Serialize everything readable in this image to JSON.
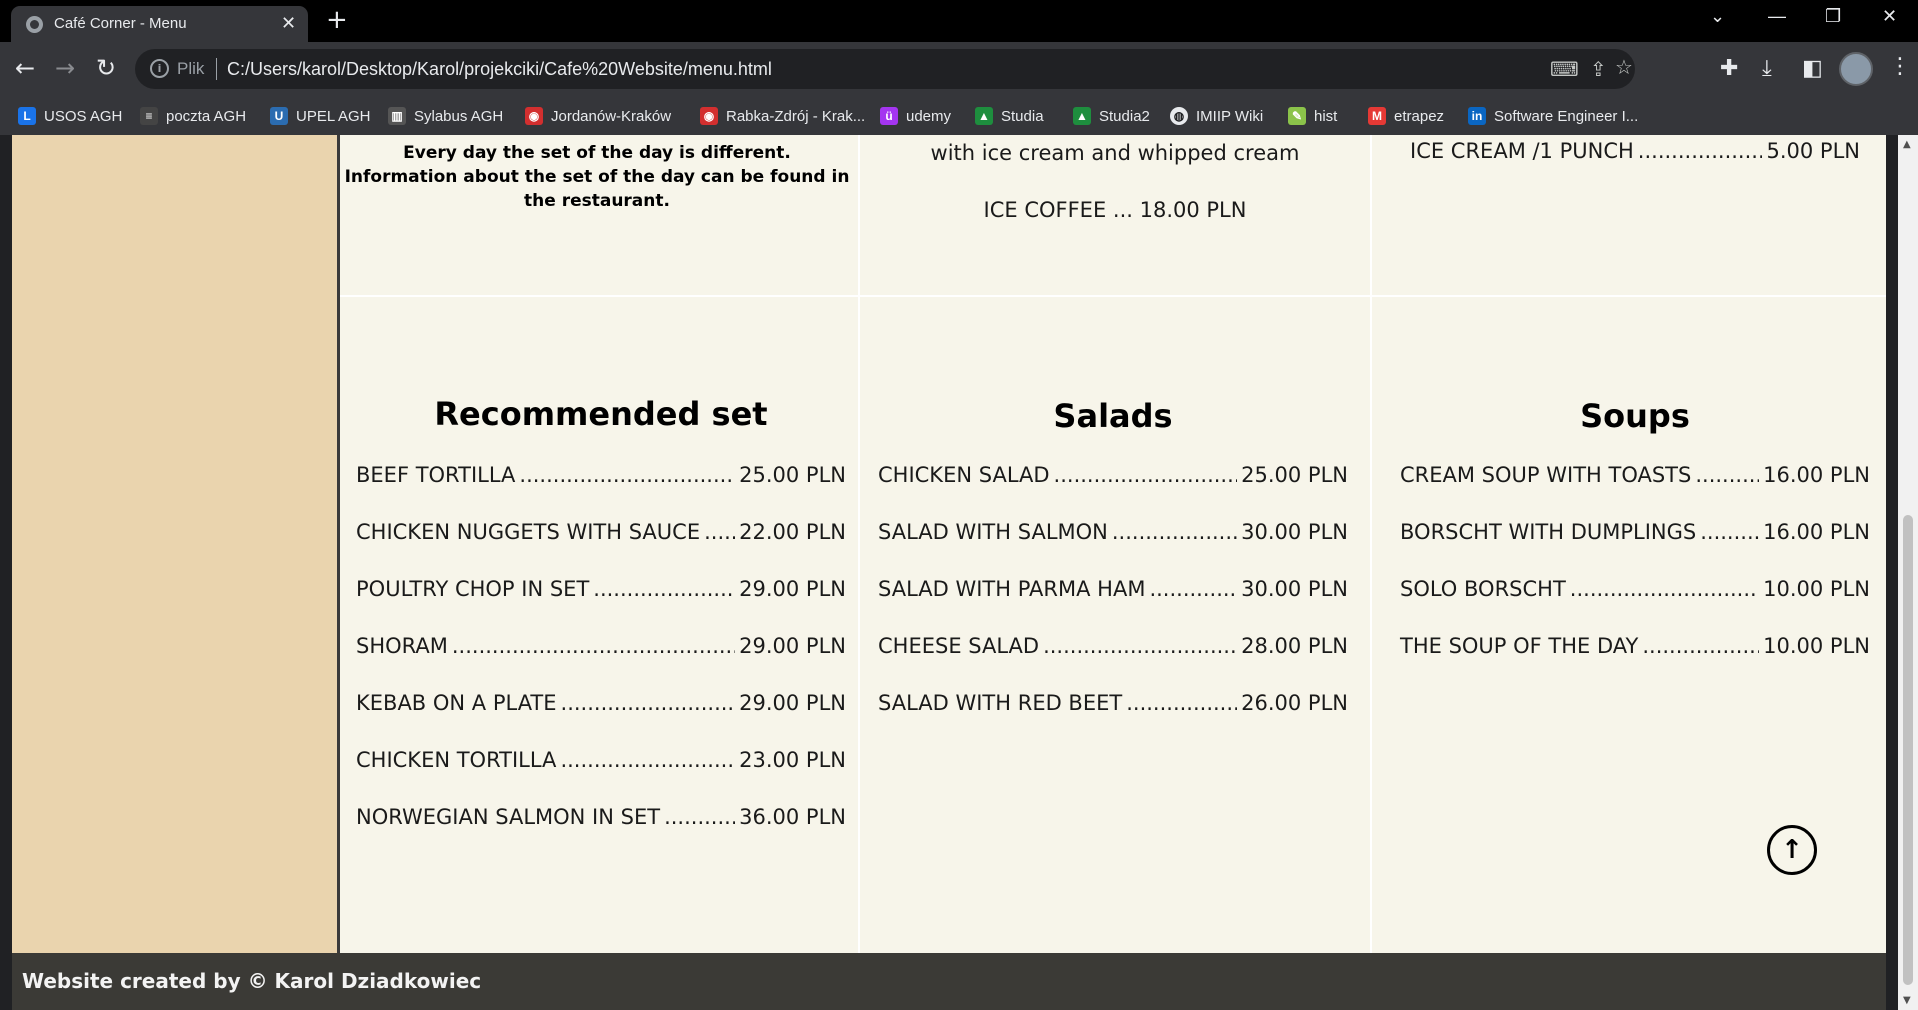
{
  "browser": {
    "tab_title": "Café Corner - Menu",
    "new_tab": "+",
    "address_scheme": "Plik",
    "address_url": "C:/Users/karol/Desktop/Karol/projekciki/Cafe%20Website/menu.html",
    "bookmarks": [
      {
        "label": "USOS AGH",
        "icon": "usos-icon",
        "color": "#1a73e8"
      },
      {
        "label": "poczta AGH",
        "icon": "mail-icon",
        "color": "#444"
      },
      {
        "label": "UPEL AGH",
        "icon": "upel-icon",
        "color": "#2b6cb0"
      },
      {
        "label": "Sylabus AGH",
        "icon": "sylabus-icon",
        "color": "#555"
      },
      {
        "label": "Jordanów-Kraków",
        "icon": "bus-icon",
        "color": "#d32f2f"
      },
      {
        "label": "Rabka-Zdrój - Krak...",
        "icon": "bus-icon",
        "color": "#d32f2f"
      },
      {
        "label": "udemy",
        "icon": "udemy-icon",
        "color": "#a435f0"
      },
      {
        "label": "Studia",
        "icon": "drive-icon",
        "color": "#1e8e3e"
      },
      {
        "label": "Studia2",
        "icon": "drive-icon",
        "color": "#1e8e3e"
      },
      {
        "label": "IMIIP Wiki",
        "icon": "globe-icon",
        "color": "#e8eaed"
      },
      {
        "label": "hist",
        "icon": "hist-icon",
        "color": "#8bc34a"
      },
      {
        "label": "etrapez",
        "icon": "etrapez-icon",
        "color": "#e53935"
      },
      {
        "label": "Software Engineer I...",
        "icon": "linkedin-icon",
        "color": "#0a66c2"
      }
    ]
  },
  "top_row": {
    "set_note": "Every day the set of the day is different. Information about the set of the day can be found in the restaurant.",
    "middle_text": "with ice cream and whipped cream",
    "middle_item": "ICE COFFEE ... 18.00 PLN",
    "right_item_name": "ICE CREAM /1 PUNCH",
    "right_item_price": "5.00 PLN"
  },
  "sections": [
    {
      "heading": "Recommended set",
      "items": [
        {
          "name": "BEEF TORTILLA",
          "price": "25.00 PLN"
        },
        {
          "name": "CHICKEN NUGGETS WITH SAUCE",
          "price": "22.00 PLN"
        },
        {
          "name": "POULTRY CHOP IN SET",
          "price": "29.00 PLN"
        },
        {
          "name": "SHORAM",
          "price": "29.00 PLN"
        },
        {
          "name": "KEBAB ON A PLATE",
          "price": "29.00 PLN"
        },
        {
          "name": "CHICKEN TORTILLA",
          "price": "23.00 PLN"
        },
        {
          "name": "NORWEGIAN SALMON IN SET",
          "price": "36.00 PLN"
        }
      ]
    },
    {
      "heading": "Salads",
      "items": [
        {
          "name": "CHICKEN SALAD",
          "price": "25.00 PLN"
        },
        {
          "name": "SALAD WITH SALMON",
          "price": "30.00 PLN"
        },
        {
          "name": "SALAD WITH PARMA HAM",
          "price": "30.00 PLN"
        },
        {
          "name": "CHEESE SALAD",
          "price": "28.00 PLN"
        },
        {
          "name": "SALAD WITH RED BEET",
          "price": "26.00 PLN"
        }
      ]
    },
    {
      "heading": "Soups",
      "items": [
        {
          "name": "CREAM SOUP WITH TOASTS",
          "price": "16.00 PLN"
        },
        {
          "name": "BORSCHT WITH DUMPLINGS",
          "price": "16.00 PLN"
        },
        {
          "name": "SOLO BORSCHT",
          "price": "10.00 PLN"
        },
        {
          "name": "THE SOUP OF THE DAY",
          "price": "10.00 PLN"
        }
      ]
    }
  ],
  "scroll_top_icon": "arrow-up-icon",
  "footer": {
    "text": "Website created by © Karol Dziadkowiec"
  },
  "colors": {
    "page_bg": "#f7f5ea",
    "sidebar_bg": "#ead4ae",
    "footer_bg": "#3b3a36"
  }
}
